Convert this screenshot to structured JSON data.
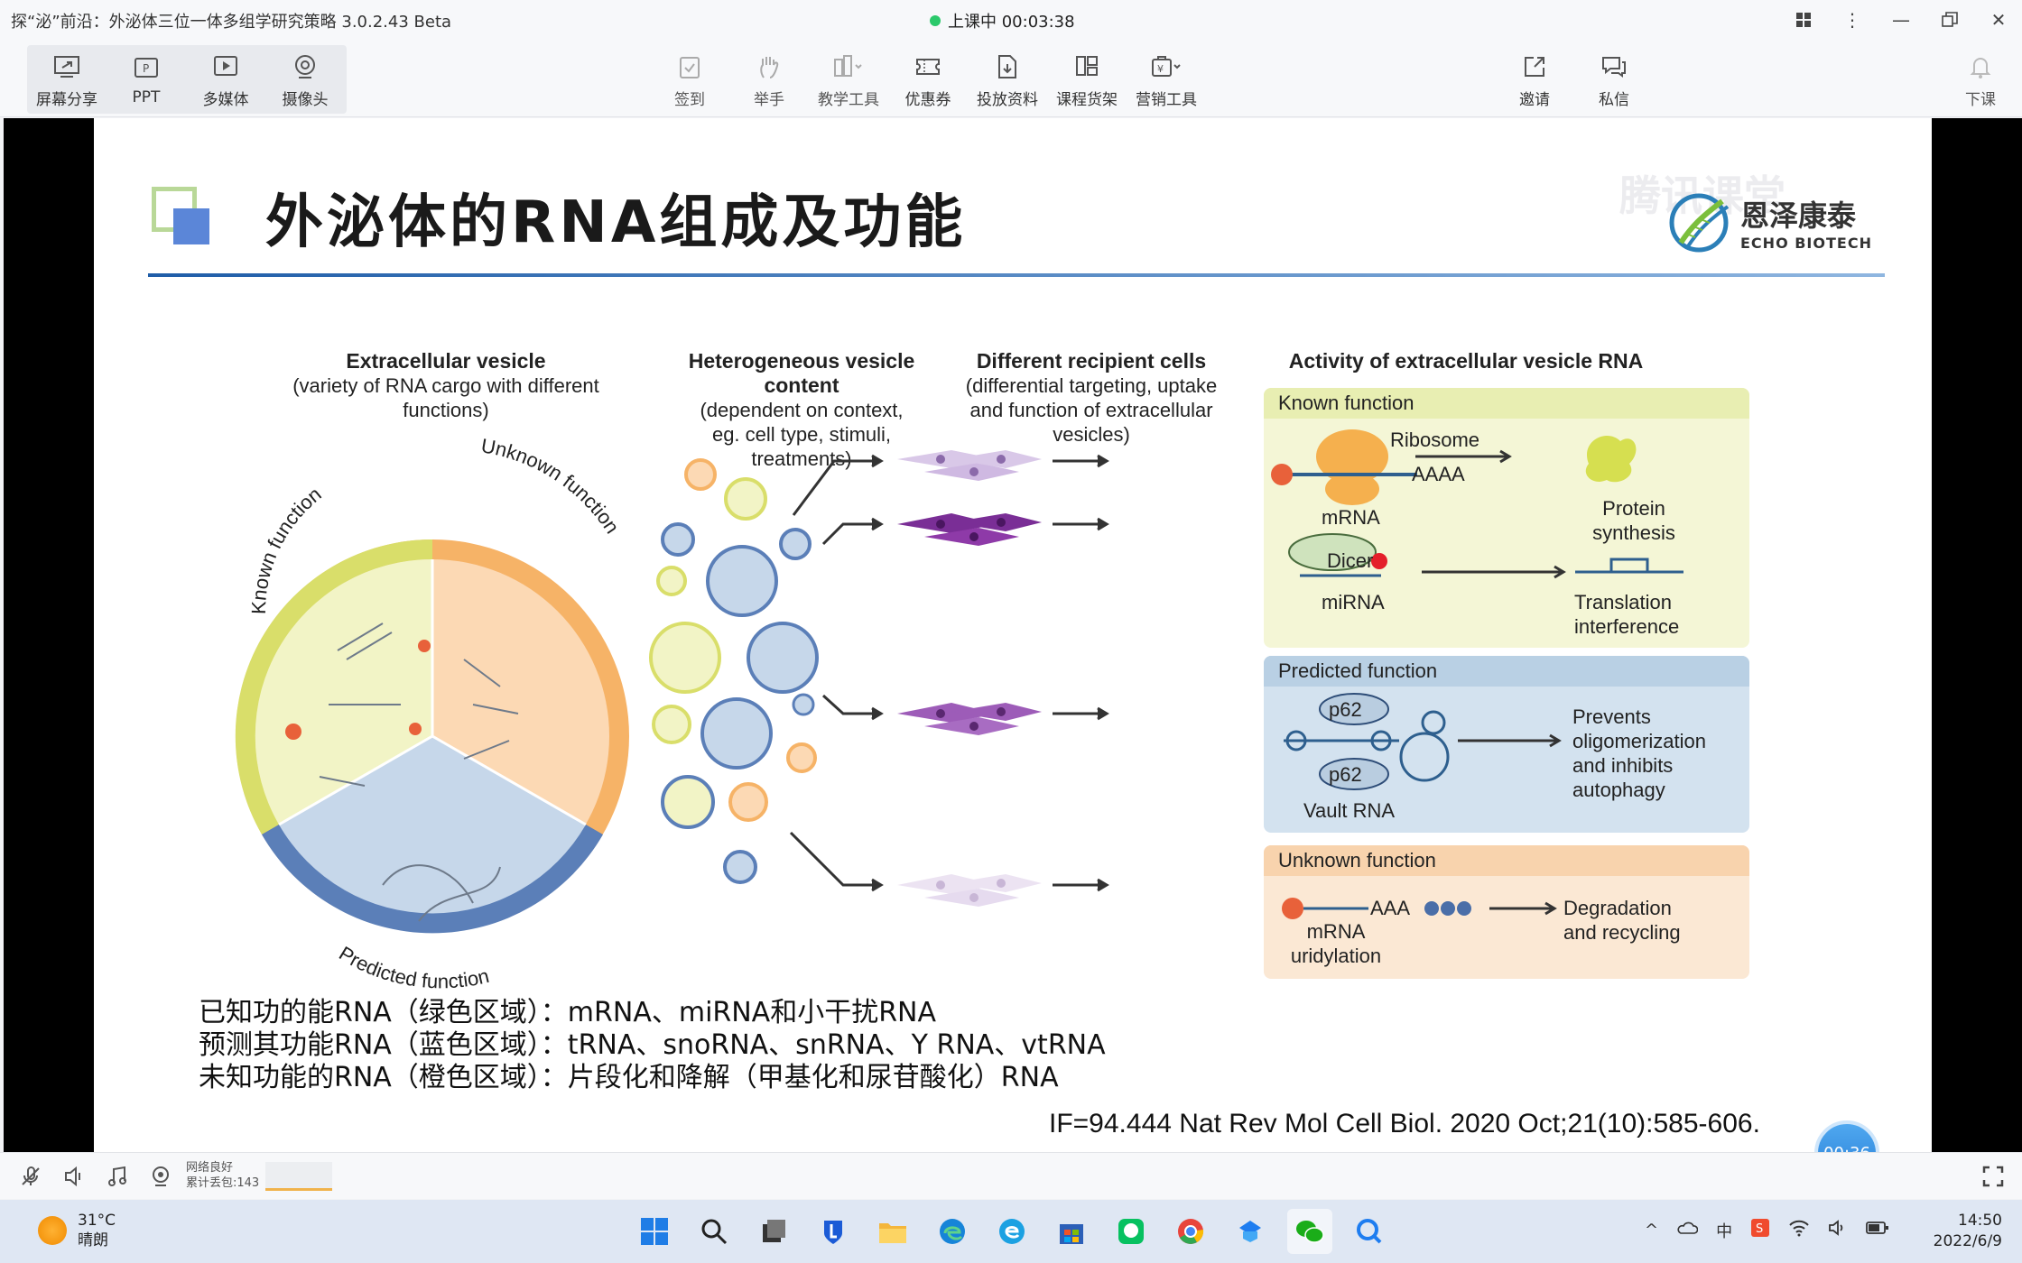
{
  "app": {
    "title": "探“泌”前沿：外泌体三位一体多组学研究策略 3.0.2.43 Beta",
    "live_status": "上课中 00:03:38"
  },
  "toolbar": {
    "left": [
      "屏幕分享",
      "PPT",
      "多媒体",
      "摄像头"
    ],
    "center": [
      "签到",
      "举手",
      "教学工具",
      "优惠券",
      "投放资料",
      "课程货架",
      "营销工具"
    ],
    "right": [
      "邀请",
      "私信"
    ],
    "end": "下课"
  },
  "slide": {
    "title": "外泌体的RNA组成及功能",
    "logo_cn": "恩泽康泰",
    "logo_en": "ECHO BIOTECH",
    "watermark": "腾讯课堂",
    "figure": {
      "col1_title": "Extracellular vesicle",
      "col1_sub": "(variety of RNA cargo with different functions)",
      "col2_title": "Heterogeneous vesicle content",
      "col2_sub": "(dependent on context, eg. cell type, stimuli, treatments)",
      "col3_title": "Different recipient cells",
      "col3_sub": "(differential targeting, uptake and function of extracellular vesicles)",
      "col4_title": "Activity of extracellular vesicle RNA",
      "arc_known": "Known function",
      "arc_unknown": "Unknown function",
      "arc_predicted": "Predicted function",
      "known_head": "Known function",
      "ribosome": "Ribosome",
      "aaaa": "AAAA",
      "mrna": "mRNA",
      "protein": "Protein synthesis",
      "dicer": "Dicer",
      "mirna": "miRNA",
      "translation": "Translation interference",
      "predicted_head": "Predicted function",
      "p62a": "p62",
      "p62b": "p62",
      "vault": "Vault RNA",
      "prevents": "Prevents oligomerization and inhibits autophagy",
      "unknown_head": "Unknown function",
      "aaa": "AAA",
      "mrna_ur": "mRNA uridylation",
      "degradation": "Degradation and recycling"
    },
    "notes": [
      "已知功的能RNA（绿色区域）：mRNA、miRNA和小干扰RNA",
      "预测其功能RNA（蓝色区域）：tRNA、snoRNA、snRNA、Y RNA、vtRNA",
      "未知功能的RNA（橙色区域）：片段化和降解（甲基化和尿苷酸化）RNA"
    ],
    "citation": "IF=94.444 Nat Rev Mol Cell Biol. 2020 Oct;21(10):585-606."
  },
  "timer": "00:36",
  "status": {
    "network": "网络良好",
    "packet_loss": "累计丢包:143"
  },
  "taskbar": {
    "temp": "31°C",
    "weather": "晴朗",
    "ime": "中",
    "time": "14:50",
    "date": "2022/6/9"
  },
  "colors": {
    "known": "#eef3c8",
    "predicted": "#c9dbe9",
    "unknown": "#fbe3c8",
    "accent": "#2a7fd6"
  }
}
